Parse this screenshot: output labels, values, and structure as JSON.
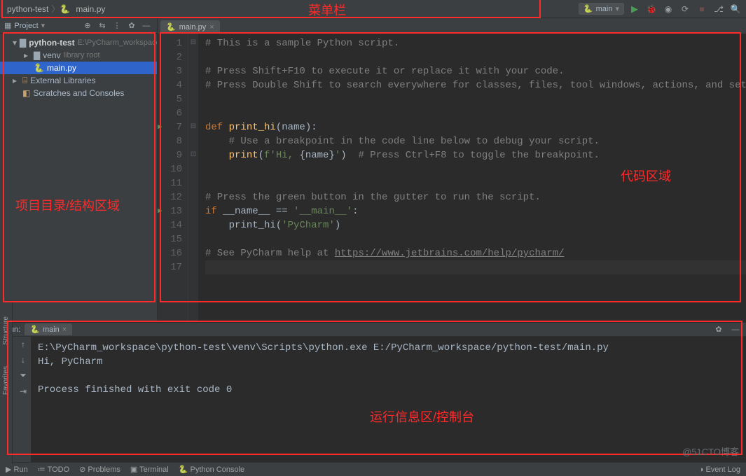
{
  "breadcrumb": {
    "project": "python-test",
    "file": "main.py"
  },
  "runConfig": {
    "name": "main"
  },
  "annotations": {
    "menubar": "菜单栏",
    "projectArea": "项目目录/结构区域",
    "codeArea": "代码区域",
    "consoleArea": "运行信息区/控制台"
  },
  "projectTool": {
    "title": "Project",
    "tree": {
      "root": "python-test",
      "rootPath": "E:\\PyCharm_workspace\\python",
      "venv": "venv",
      "venvNote": "library root",
      "mainFile": "main.py",
      "extLib": "External Libraries",
      "scratches": "Scratches and Consoles"
    }
  },
  "editor": {
    "tab": "main.py",
    "lines": [
      "# This is a sample Python script.",
      "",
      "# Press Shift+F10 to execute it or replace it with your code.",
      "# Press Double Shift to search everywhere for classes, files, tool windows, actions, and settings.",
      "",
      "",
      "def print_hi(name):",
      "    # Use a breakpoint in the code line below to debug your script.",
      "    print(f'Hi, {name}')  # Press Ctrl+F8 to toggle the breakpoint.",
      "",
      "",
      "# Press the green button in the gutter to run the script.",
      "if __name__ == '__main__':",
      "    print_hi('PyCharm')",
      "",
      "# See PyCharm help at https://www.jetbrains.com/help/pycharm/",
      ""
    ],
    "link": "https://www.jetbrains.com/help/pycharm/"
  },
  "run": {
    "label": "Run:",
    "tab": "main",
    "output": [
      "E:\\PyCharm_workspace\\python-test\\venv\\Scripts\\python.exe E:/PyCharm_workspace/python-test/main.py",
      "Hi, PyCharm",
      "",
      "Process finished with exit code 0"
    ]
  },
  "status": {
    "run": "Run",
    "todo": "TODO",
    "problems": "Problems",
    "terminal": "Terminal",
    "pyconsole": "Python Console",
    "eventlog": "Event Log"
  },
  "sideLabels": {
    "structure": "Structure",
    "favorites": "Favorites"
  },
  "watermark": "@51CTO博客"
}
